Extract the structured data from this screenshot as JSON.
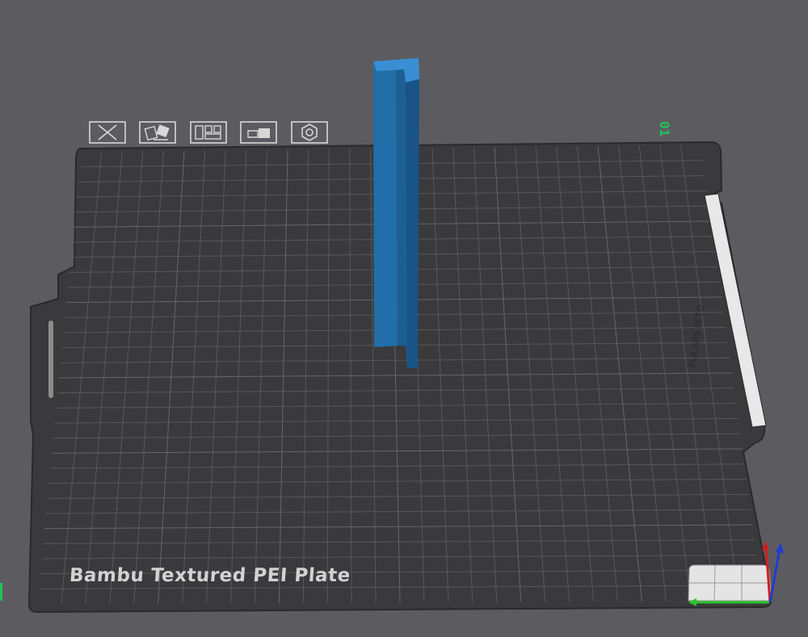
{
  "plate": {
    "title": "Bambu Textured PEI Plate",
    "number": "01",
    "side_label": "PLA ABS PETG"
  },
  "toolbar": [
    {
      "name": "delete-plate-button",
      "icon": "close-icon"
    },
    {
      "name": "auto-orient-button",
      "icon": "orient-icon"
    },
    {
      "name": "arrange-button",
      "icon": "arrange-icon"
    },
    {
      "name": "lock-plate-button",
      "icon": "lock-icon"
    },
    {
      "name": "plate-settings-button",
      "icon": "gear-icon"
    }
  ],
  "colors": {
    "background": "#5c5c60",
    "plate": "#3a3a3c",
    "grid": "#555558",
    "model": "#1f6fa6",
    "plate_number": "#1fc15a",
    "axis_x": "#2bc42b",
    "axis_y": "#d11f1f",
    "axis_z": "#1f3cd1"
  }
}
